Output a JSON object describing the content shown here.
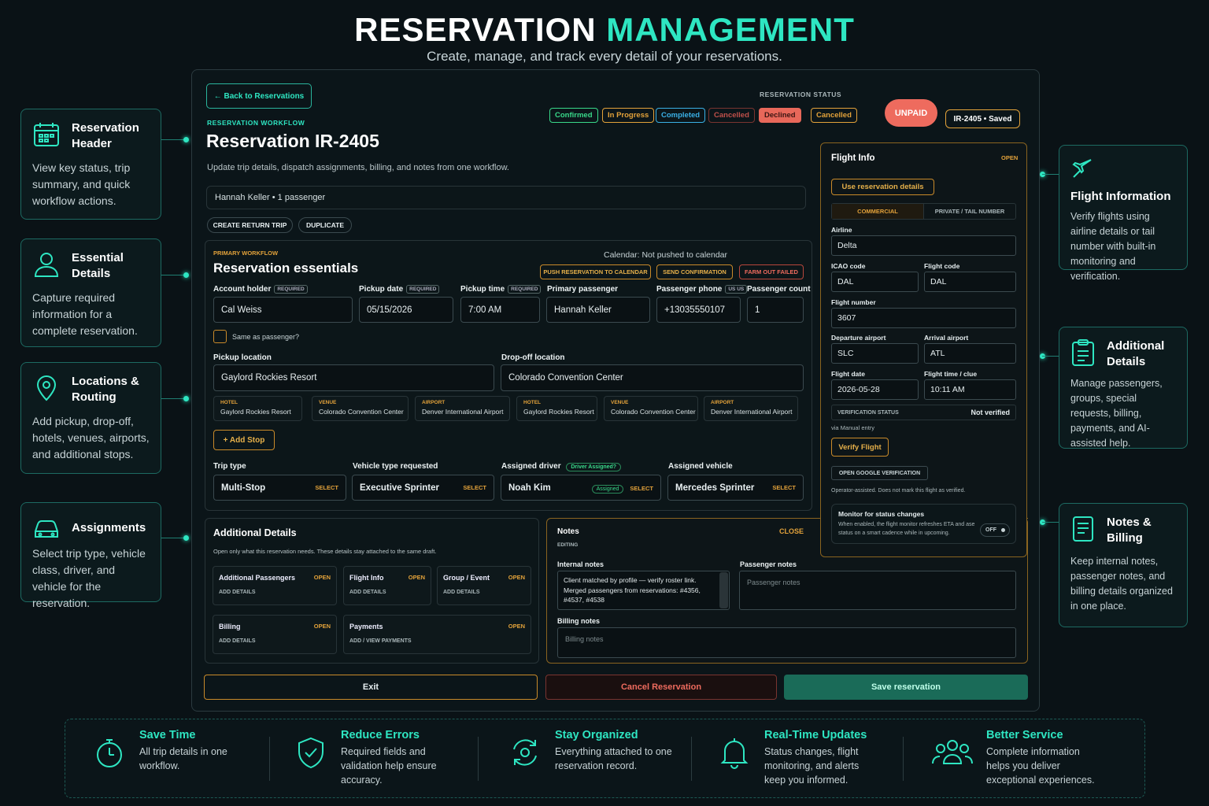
{
  "hero": {
    "title_a": "RESERVATION",
    "title_b": "MANAGEMENT",
    "subtitle": "Create, manage, and track every detail of your reservations."
  },
  "left_cards": [
    {
      "icon": "calendar-icon",
      "title": "Reservation Header",
      "body": "View key status, trip summary, and quick workflow actions."
    },
    {
      "icon": "user-icon",
      "title": "Essential Details",
      "body": "Capture required information for a complete reservation."
    },
    {
      "icon": "map-pin-icon",
      "title": "Locations & Routing",
      "body": "Add pickup, drop-off, hotels, venues, airports, and additional stops."
    },
    {
      "icon": "car-icon",
      "title": "Assignments",
      "body": "Select trip type, vehicle class, driver, and vehicle for the reservation."
    }
  ],
  "right_cards": [
    {
      "icon": "plane-icon",
      "title": "Flight Information",
      "body": "Verify flights using airline details or tail number with built-in monitoring and verification."
    },
    {
      "icon": "clipboard-icon",
      "title": "Additional Details",
      "body": "Manage passengers, groups, special requests, billing, payments, and AI-assisted help."
    },
    {
      "icon": "notes-icon",
      "title": "Notes & Billing",
      "body": "Keep internal notes, passenger notes, and billing details organized in one place."
    }
  ],
  "header": {
    "back": "← Back to Reservations",
    "workflow_label": "RESERVATION WORKFLOW",
    "title": "Reservation IR-2405",
    "description": "Update trip details, dispatch assignments, billing, and notes from one workflow.",
    "summary": "Hannah Keller • 1 passenger",
    "create_return": "CREATE RETURN TRIP",
    "duplicate": "DUPLICATE",
    "status_label": "RESERVATION STATUS",
    "statuses": [
      "Confirmed",
      "In Progress",
      "Completed",
      "Cancelled",
      "Declined",
      "Cancelled"
    ],
    "status_colors": [
      "#39d98a",
      "#e3a23a",
      "#3ab0e6",
      "#c0504a",
      "#ff7a6a",
      "#e3a23a"
    ],
    "payment": "UNPAID",
    "saved": "IR-2405 • Saved"
  },
  "essentials": {
    "kicker": "PRIMARY WORKFLOW",
    "title": "Reservation essentials",
    "calendar": "Calendar: Not pushed to calendar",
    "push": "PUSH RESERVATION TO CALENDAR",
    "send": "SEND CONFIRMATION",
    "farm": "FARM OUT FAILED",
    "account_label": "Account holder",
    "account": "Cal Weiss",
    "date_label": "Pickup date",
    "date": "05/15/2026",
    "time_label": "Pickup time",
    "time": "7:00 AM",
    "passenger_label": "Primary passenger",
    "passenger": "Hannah Keller",
    "phone_label": "Passenger phone",
    "phone_tag": "US US",
    "phone": "+13035550107",
    "count_label": "Passenger count",
    "count": "1",
    "required": "REQUIRED",
    "same": "Same as passenger?",
    "pickup_label": "Pickup location",
    "pickup": "Gaylord Rockies Resort",
    "dropoff_label": "Drop-off location",
    "dropoff": "Colorado Convention Center",
    "chips": [
      {
        "k": "HOTEL",
        "v": "Gaylord Rockies Resort"
      },
      {
        "k": "VENUE",
        "v": "Colorado Convention Center"
      },
      {
        "k": "AIRPORT",
        "v": "Denver International Airport"
      },
      {
        "k": "HOTEL",
        "v": "Gaylord Rockies Resort"
      },
      {
        "k": "VENUE",
        "v": "Colorado Convention Center"
      },
      {
        "k": "AIRPORT",
        "v": "Denver International Airport"
      }
    ],
    "add_stop": "+ Add Stop",
    "trip_label": "Trip type",
    "trip": "Multi-Stop",
    "vehicle_type_label": "Vehicle type requested",
    "vehicle_type": "Executive Sprinter",
    "driver_label": "Assigned driver",
    "driver_badge": "Driver Assigned?",
    "driver": "Noah Kim",
    "assigned": "Assigned",
    "vehicle_label": "Assigned vehicle",
    "vehicle": "Mercedes Sprinter",
    "select": "SELECT"
  },
  "additional": {
    "title": "Additional Details",
    "desc": "Open only what this reservation needs. These details stay attached to the same draft.",
    "cards": [
      {
        "t": "Additional Passengers",
        "o": "OPEN",
        "a": "ADD DETAILS"
      },
      {
        "t": "Flight Info",
        "o": "OPEN",
        "a": "ADD DETAILS"
      },
      {
        "t": "Group / Event",
        "o": "OPEN",
        "a": "ADD DETAILS"
      },
      {
        "t": "Billing",
        "o": "OPEN",
        "a": "ADD DETAILS"
      },
      {
        "t": "Payments",
        "o": "OPEN",
        "a": "ADD / VIEW PAYMENTS"
      }
    ]
  },
  "notes": {
    "title": "Notes",
    "editing": "EDITING",
    "close": "CLOSE",
    "internal_label": "Internal notes",
    "internal": "Client matched by profile — verify roster link. Merged passengers from reservations: #4356, #4537, #4538",
    "passenger_label": "Passenger notes",
    "passenger_ph": "Passenger notes",
    "billing_label": "Billing notes",
    "billing_ph": "Billing notes"
  },
  "flight": {
    "title": "Flight Info",
    "open": "OPEN",
    "use": "Use reservation details",
    "tab_commercial": "COMMERCIAL",
    "tab_private": "PRIVATE / TAIL NUMBER",
    "airline_label": "Airline",
    "airline": "Delta",
    "icao_label": "ICAO code",
    "icao": "DAL",
    "code_label": "Flight code",
    "code": "DAL",
    "number_label": "Flight number",
    "number": "3607",
    "dep_label": "Departure airport",
    "dep": "SLC",
    "arr_label": "Arrival airport",
    "arr": "ATL",
    "fdate_label": "Flight date",
    "fdate": "2026-05-28",
    "ftime_label": "Flight time / clue",
    "ftime": "10:11 AM",
    "verif_label": "VERIFICATION STATUS",
    "verif": "Not verified",
    "via": "via Manual entry",
    "verify": "Verify Flight",
    "google": "OPEN GOOGLE VERIFICATION",
    "operator": "Operator-assisted. Does not mark this flight as verified.",
    "monitor_title": "Monitor for status changes",
    "monitor_desc": "When enabled, the flight monitor refreshes ETA and ase status on a smart cadence while in upcoming.",
    "toggle": "OFF"
  },
  "footer_actions": {
    "exit": "Exit",
    "cancel": "Cancel Reservation",
    "save": "Save reservation"
  },
  "features": [
    {
      "icon": "stopwatch-icon",
      "title": "Save Time",
      "body": "All trip details in one workflow."
    },
    {
      "icon": "shield-check-icon",
      "title": "Reduce Errors",
      "body": "Required fields and validation help ensure accuracy."
    },
    {
      "icon": "sync-icon",
      "title": "Stay Organized",
      "body": "Everything attached to one reservation record."
    },
    {
      "icon": "bell-icon",
      "title": "Real-Time Updates",
      "body": "Status changes, flight monitoring, and alerts keep you informed."
    },
    {
      "icon": "users-icon",
      "title": "Better Service",
      "body": "Complete information helps you deliver exceptional experiences."
    }
  ],
  "colors": {
    "accent": "#2ee6c2",
    "amber": "#e3a23a",
    "danger": "#e8685a",
    "save": "#1a6b58"
  }
}
